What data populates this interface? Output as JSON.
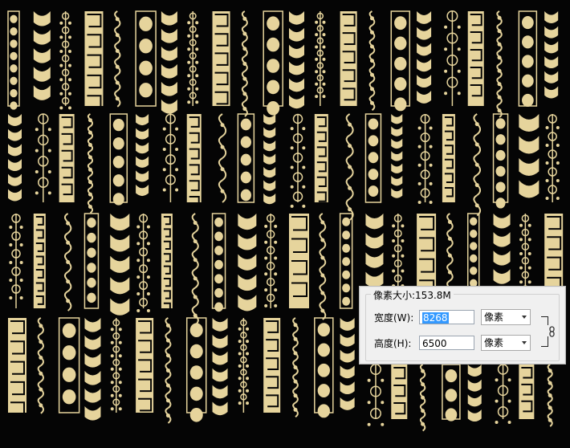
{
  "dialog": {
    "legend": "像素大小:153.8M",
    "width_label": "宽度(W):",
    "width_value": "8268",
    "width_unit": "像素",
    "height_label": "高度(H):",
    "height_value": "6500",
    "height_unit": "像素",
    "link_icon": "chain-link-icon"
  },
  "colors": {
    "background": "#050505",
    "ornament": "#e6d49c",
    "selection": "#3399ff"
  }
}
